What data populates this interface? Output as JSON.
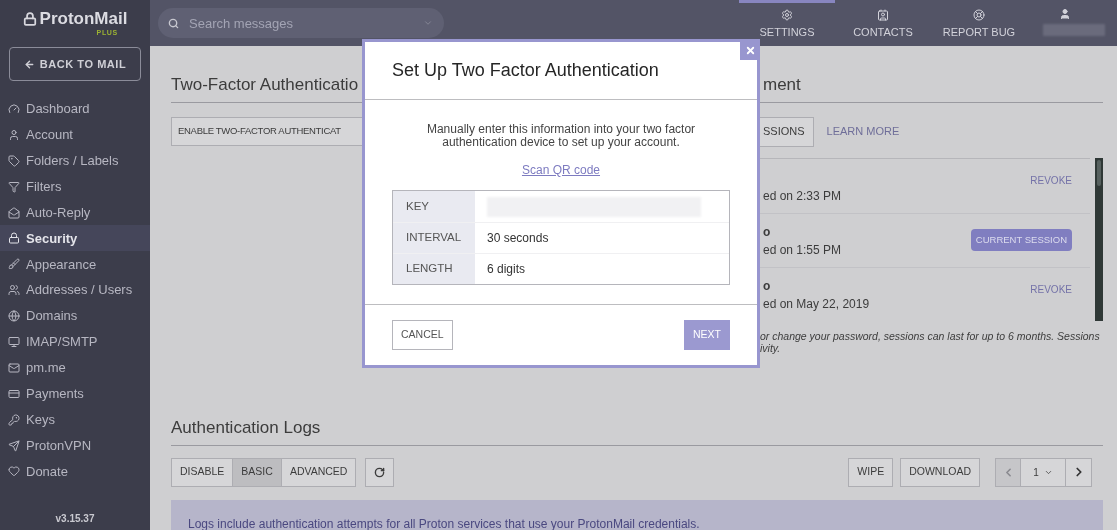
{
  "app": {
    "logo": "ProtonMail",
    "plan": "PLUS",
    "back_button": "BACK TO MAIL",
    "version": "v3.15.37"
  },
  "sidebar": {
    "items": [
      {
        "label": "Dashboard",
        "selected": false
      },
      {
        "label": "Account",
        "selected": false
      },
      {
        "label": "Folders / Labels",
        "selected": false
      },
      {
        "label": "Filters",
        "selected": false
      },
      {
        "label": "Auto-Reply",
        "selected": false
      },
      {
        "label": "Security",
        "selected": true
      },
      {
        "label": "Appearance",
        "selected": false
      },
      {
        "label": "Addresses / Users",
        "selected": false
      },
      {
        "label": "Domains",
        "selected": false
      },
      {
        "label": "IMAP/SMTP",
        "selected": false
      },
      {
        "label": "pm.me",
        "selected": false
      },
      {
        "label": "Payments",
        "selected": false
      },
      {
        "label": "Keys",
        "selected": false
      },
      {
        "label": "ProtonVPN",
        "selected": false
      },
      {
        "label": "Donate",
        "selected": false
      }
    ]
  },
  "header": {
    "search": {
      "placeholder": "Search messages"
    },
    "nav": [
      {
        "label": "SETTINGS",
        "selected": true
      },
      {
        "label": "CONTACTS",
        "selected": false
      },
      {
        "label": "REPORT BUG",
        "selected": false
      }
    ]
  },
  "two_factor": {
    "heading": "Two-Factor Authenticatio",
    "button": "ENABLE TWO-FACTOR AUTHENTICAT"
  },
  "sessions": {
    "heading": "ment",
    "button": "SSIONS",
    "link": "LEARN MORE",
    "rows": [
      {
        "text": "ed on 2:33 PM",
        "action": "REVOKE",
        "current": false
      },
      {
        "name": "o",
        "text": "ed on 1:55 PM",
        "action": "CURRENT SESSION",
        "current": true
      },
      {
        "name": "o",
        "text": "ed on May 22, 2019",
        "action": "REVOKE",
        "current": false
      }
    ],
    "note": [
      "or change your password, sessions can last for up to 6 months. Sessions",
      "ivity."
    ]
  },
  "modal": {
    "title": "Set Up Two Factor Authentication",
    "intro": "Manually enter this information into your two factor authentication device to set up your account.",
    "qr_link": "Scan QR code",
    "fields": [
      {
        "label": "KEY"
      },
      {
        "label": "INTERVAL",
        "value": "30 seconds"
      },
      {
        "label": "LENGTH",
        "value": "6 digits"
      }
    ],
    "cancel": "CANCEL",
    "next": "NEXT"
  },
  "logs": {
    "heading": "Authentication Logs",
    "modes": [
      {
        "label": "DISABLE",
        "selected": false
      },
      {
        "label": "BASIC",
        "selected": true
      },
      {
        "label": "ADVANCED",
        "selected": false
      }
    ],
    "wipe": "WIPE",
    "download": "DOWNLOAD",
    "page": "1",
    "info": "Logs include authentication attempts for all Proton services that use your ProtonMail credentials."
  }
}
